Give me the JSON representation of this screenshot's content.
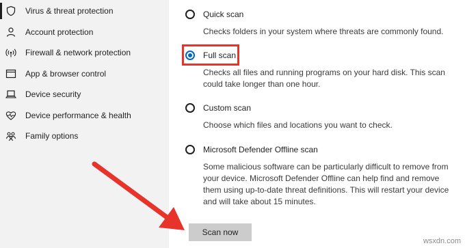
{
  "sidebar": {
    "items": [
      {
        "label": "Virus & threat protection",
        "icon": "shield-icon",
        "selected": true
      },
      {
        "label": "Account protection",
        "icon": "person-icon",
        "selected": false
      },
      {
        "label": "Firewall & network protection",
        "icon": "wifi-signal-icon",
        "selected": false
      },
      {
        "label": "App & browser control",
        "icon": "app-window-icon",
        "selected": false
      },
      {
        "label": "Device security",
        "icon": "laptop-icon",
        "selected": false
      },
      {
        "label": "Device performance & health",
        "icon": "heart-pulse-icon",
        "selected": false
      },
      {
        "label": "Family options",
        "icon": "family-icon",
        "selected": false
      }
    ]
  },
  "scan_options": [
    {
      "label": "Quick scan",
      "description": "Checks folders in your system where threats are commonly found.",
      "checked": false
    },
    {
      "label": "Full scan",
      "description": "Checks all files and running programs on your hard disk. This scan could take longer than one hour.",
      "checked": true
    },
    {
      "label": "Custom scan",
      "description": "Choose which files and locations you want to check.",
      "checked": false
    },
    {
      "label": "Microsoft Defender Offline scan",
      "description": "Some malicious software can be particularly difficult to remove from your device. Microsoft Defender Offline can help find and remove them using up-to-date threat definitions. This will restart your device and will take about 15 minutes.",
      "checked": false
    }
  ],
  "scan_button": {
    "label": "Scan now"
  },
  "watermark": "wsxdn.com",
  "colors": {
    "sidebar_bg": "#f2f2f2",
    "accent": "#0067c0",
    "highlight": "#e8332a",
    "button_bg": "#cccccc"
  }
}
